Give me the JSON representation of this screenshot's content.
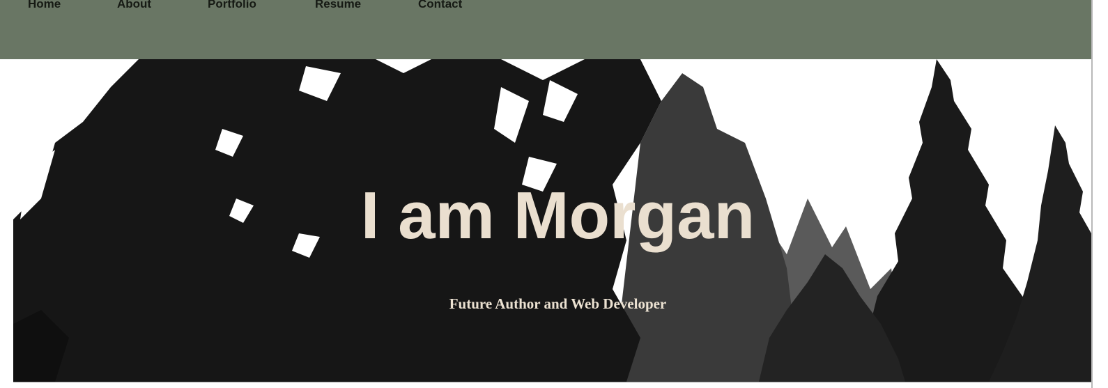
{
  "nav": {
    "items": [
      {
        "label": "Home"
      },
      {
        "label": "About"
      },
      {
        "label": "Portfolio"
      },
      {
        "label": "Resume"
      },
      {
        "label": "Contact"
      }
    ],
    "background": "#697664"
  },
  "hero": {
    "title": "I am Morgan",
    "subtitle": "Future Author and Web Developer",
    "title_color": "#eadfcf",
    "image": "forest-silhouette-image"
  }
}
